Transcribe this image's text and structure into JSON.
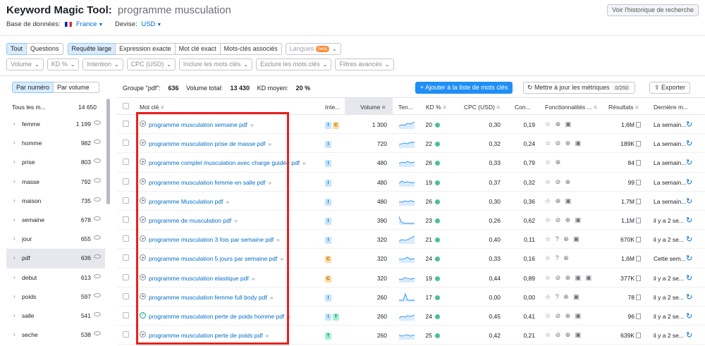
{
  "header": {
    "title": "Keyword Magic Tool:",
    "query": "programme musculation",
    "db_label": "Base de données:",
    "db_value": "France",
    "currency_label": "Devise:",
    "currency_value": "USD",
    "history_button": "Voir l'historique de recherche"
  },
  "filters": {
    "match_tabs": [
      "Tout",
      "Questions"
    ],
    "match_types": [
      "Requête large",
      "Expression exacte",
      "Mot clé exact",
      "Mots-clés associés"
    ],
    "languages_label": "Langues",
    "beta_label": "beta",
    "row2": [
      "Volume",
      "KD %",
      "Intention",
      "CPC (USD)",
      "Inclure les mots clés",
      "Exclure les mots clés",
      "Filtres avancés"
    ]
  },
  "sidebar": {
    "toggle_selected": "Par numéro",
    "toggle_other": "Par volume",
    "all_label": "Tous les m...",
    "all_count": "14 650",
    "items": [
      {
        "label": "femme",
        "count": "1 199"
      },
      {
        "label": "homme",
        "count": "982"
      },
      {
        "label": "prise",
        "count": "803"
      },
      {
        "label": "masse",
        "count": "792"
      },
      {
        "label": "maison",
        "count": "735"
      },
      {
        "label": "semaine",
        "count": "678"
      },
      {
        "label": "jour",
        "count": "655"
      },
      {
        "label": "pdf",
        "count": "636"
      },
      {
        "label": "debut",
        "count": "613"
      },
      {
        "label": "poids",
        "count": "597"
      },
      {
        "label": "salle",
        "count": "541"
      },
      {
        "label": "seche",
        "count": "538"
      }
    ]
  },
  "summary": {
    "group_label": "Groupe \"pdf\":",
    "group_value": "636",
    "volume_label": "Volume total:",
    "volume_value": "13 430",
    "kd_label": "KD moyen:",
    "kd_value": "20 %"
  },
  "actions": {
    "add_label": "+  Ajouter à la liste de mots clés",
    "update_label": "Mettre à jour les métriques",
    "update_badge": "0/250",
    "export_label": "Exporter"
  },
  "columns": {
    "keyword": "Mot clé",
    "intent": "Inte...",
    "volume": "Volume",
    "trend": "Ten...",
    "kd": "KD %",
    "cpc": "CPC (USD)",
    "com": "Con...",
    "features": "Fonctionnalités ...",
    "results": "Résultats",
    "last": "Dernière m..."
  },
  "rows": [
    {
      "kw": "programme musculation semaine pdf",
      "intent": [
        "I",
        "C"
      ],
      "vol": "1 300",
      "kd": "20",
      "cpc": "0,30",
      "com": "0,19",
      "res": "1,6M",
      "last": "La semain...",
      "added": false
    },
    {
      "kw": "programme musculation prise de masse pdf",
      "intent": [
        "I"
      ],
      "vol": "720",
      "kd": "22",
      "cpc": "0,32",
      "com": "0,24",
      "res": "189K",
      "last": "La semain...",
      "added": false
    },
    {
      "kw": "programme complet musculation avec charge guidée pdf",
      "intent": [
        "I"
      ],
      "vol": "480",
      "kd": "26",
      "cpc": "0,33",
      "com": "0,79",
      "res": "84",
      "last": "La semain...",
      "added": false
    },
    {
      "kw": "programme musculation femme en salle pdf",
      "intent": [
        "I"
      ],
      "vol": "480",
      "kd": "19",
      "cpc": "0,37",
      "com": "0,32",
      "res": "99",
      "last": "La semain...",
      "added": false
    },
    {
      "kw": "programme Musculation pdf",
      "intent": [
        "I"
      ],
      "vol": "480",
      "kd": "26",
      "cpc": "0,30",
      "com": "0,36",
      "res": "1,7M",
      "last": "La semain...",
      "added": false
    },
    {
      "kw": "programme de musculation pdf",
      "intent": [
        "I"
      ],
      "vol": "390",
      "kd": "23",
      "cpc": "0,26",
      "com": "0,62",
      "res": "1,1M",
      "last": "il y a 2 se...",
      "added": false
    },
    {
      "kw": "programme musculation 3 fois par semaine pdf",
      "intent": [
        "I"
      ],
      "vol": "320",
      "kd": "21",
      "cpc": "0,40",
      "com": "0,11",
      "res": "670K",
      "last": "il y a 2 se...",
      "added": false
    },
    {
      "kw": "programme musculation 5 jours par semaine pdf",
      "intent": [
        "C"
      ],
      "vol": "320",
      "kd": "24",
      "cpc": "0,33",
      "com": "0,16",
      "res": "1,6M",
      "last": "Cette sem...",
      "added": false
    },
    {
      "kw": "programme musculation elastique pdf",
      "intent": [
        "C"
      ],
      "vol": "320",
      "kd": "19",
      "cpc": "0,44",
      "com": "0,89",
      "res": "377K",
      "last": "il y a 2 se...",
      "added": false
    },
    {
      "kw": "programme musculation femme full body pdf",
      "intent": [
        "I"
      ],
      "vol": "260",
      "kd": "17",
      "cpc": "0,00",
      "com": "0,00",
      "res": "78",
      "last": "il y a 2 se...",
      "added": false
    },
    {
      "kw": "programme musculation perte de poids homme pdf",
      "intent": [
        "I",
        "T"
      ],
      "vol": "260",
      "kd": "24",
      "cpc": "0,45",
      "com": "0,41",
      "res": "96",
      "last": "il y a 2 se...",
      "added": true
    },
    {
      "kw": "programme musculation perte de poids pdf",
      "intent": [
        "T"
      ],
      "vol": "260",
      "kd": "25",
      "cpc": "0,42",
      "com": "0,21",
      "res": "639K",
      "last": "il y a 2 se...",
      "added": false
    }
  ],
  "colors": {
    "accent": "#1f8ff5",
    "link": "#006dca",
    "kd_easy": "#48c195",
    "highlight_box": "#e8211c"
  }
}
